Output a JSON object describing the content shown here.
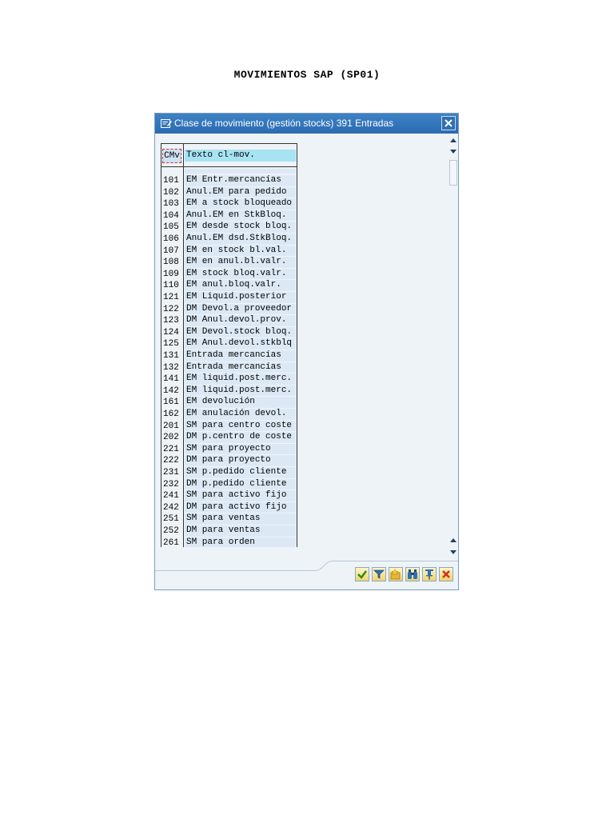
{
  "document": {
    "title": "MOVIMIENTOS SAP (SP01)"
  },
  "dialog": {
    "title": "Clase de movimiento (gestión stocks) 391 Entradas",
    "columns": {
      "code": "CMv",
      "text": "Texto cl-mov."
    },
    "rows": [
      {
        "code": "101",
        "text": "EM Entr.mercancías"
      },
      {
        "code": "102",
        "text": "Anul.EM para pedido"
      },
      {
        "code": "103",
        "text": "EM a stock bloqueado"
      },
      {
        "code": "104",
        "text": "Anul.EM en StkBloq."
      },
      {
        "code": "105",
        "text": "EM desde stock bloq."
      },
      {
        "code": "106",
        "text": "Anul.EM dsd.StkBloq."
      },
      {
        "code": "107",
        "text": "EM en stock bl.val."
      },
      {
        "code": "108",
        "text": "EM en anul.bl.valr."
      },
      {
        "code": "109",
        "text": "EM stock bloq.valr."
      },
      {
        "code": "110",
        "text": "EM anul.bloq.valr."
      },
      {
        "code": "121",
        "text": "EM Liquid.posterior"
      },
      {
        "code": "122",
        "text": "DM Devol.a proveedor"
      },
      {
        "code": "123",
        "text": "DM Anul.devol.prov."
      },
      {
        "code": "124",
        "text": "EM Devol.stock bloq."
      },
      {
        "code": "125",
        "text": "EM Anul.devol.stkblq"
      },
      {
        "code": "131",
        "text": "Entrada mercancías"
      },
      {
        "code": "132",
        "text": "Entrada mercancías"
      },
      {
        "code": "141",
        "text": "EM liquid.post.merc."
      },
      {
        "code": "142",
        "text": "EM liquid.post.merc."
      },
      {
        "code": "161",
        "text": "EM devolución"
      },
      {
        "code": "162",
        "text": "EM anulación devol."
      },
      {
        "code": "201",
        "text": "SM para centro coste"
      },
      {
        "code": "202",
        "text": "DM p.centro de coste"
      },
      {
        "code": "221",
        "text": "SM para proyecto"
      },
      {
        "code": "222",
        "text": "DM para proyecto"
      },
      {
        "code": "231",
        "text": "SM p.pedido cliente"
      },
      {
        "code": "232",
        "text": "DM p.pedido cliente"
      },
      {
        "code": "241",
        "text": "SM para activo fijo"
      },
      {
        "code": "242",
        "text": "DM para activo fijo"
      },
      {
        "code": "251",
        "text": "SM para ventas"
      },
      {
        "code": "252",
        "text": "DM para ventas"
      },
      {
        "code": "261",
        "text": "SM para orden"
      }
    ],
    "toolbar": [
      {
        "name": "confirm-button",
        "icon": "checkmark-icon"
      },
      {
        "name": "filter-button",
        "icon": "filter-icon"
      },
      {
        "name": "new-selection-button",
        "icon": "star-folder-icon"
      },
      {
        "name": "find-button",
        "icon": "binoculars-icon"
      },
      {
        "name": "pin-button",
        "icon": "pin-icon"
      },
      {
        "name": "cancel-button",
        "icon": "cancel-icon"
      }
    ]
  },
  "colors": {
    "titlebar": "#2a6bb0",
    "header_highlight": "#a6e3f3",
    "row_bg": "#dce9f5",
    "dialog_bg": "#eef3f8"
  }
}
